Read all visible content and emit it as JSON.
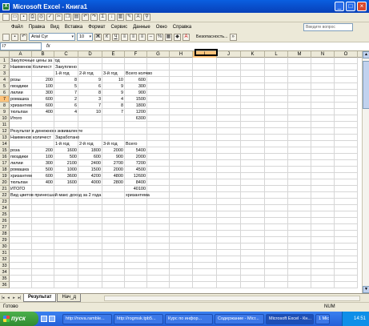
{
  "window": {
    "title": "Microsoft Excel - Книга1",
    "icon": "excel-icon"
  },
  "menu": [
    "Файл",
    "Правка",
    "Вид",
    "Вставка",
    "Формат",
    "Сервис",
    "Данные",
    "Окно",
    "Справка"
  ],
  "help_placeholder": "Введите вопрос",
  "font_name": "Arial Cyr",
  "font_size": "10",
  "security_label": "Безопасность...",
  "name_box": "I7",
  "formula_label": "fx",
  "columns": [
    "A",
    "B",
    "C",
    "D",
    "E",
    "F",
    "G",
    "H",
    "I",
    "J",
    "K",
    "L",
    "M",
    "N",
    "O"
  ],
  "selected_column": "I",
  "selected_row": 7,
  "rows": [
    {
      "n": 1,
      "cells": {
        "A": "Закупочные цены за год"
      }
    },
    {
      "n": 2,
      "cells": {
        "A": "Наименов",
        "B": "Количест",
        "C": "Закуплено"
      }
    },
    {
      "n": 3,
      "cells": {
        "C": "1-й год",
        "D": "2-й год",
        "E": "3-й год",
        "F": "Всего колчво"
      }
    },
    {
      "n": 4,
      "cells": {
        "A": "розы",
        "B": "200",
        "C": "8",
        "D": "9",
        "E": "10",
        "F": "600"
      }
    },
    {
      "n": 5,
      "cells": {
        "A": "гвоздики",
        "B": "100",
        "C": "5",
        "D": "6",
        "E": "9",
        "F": "300"
      }
    },
    {
      "n": 6,
      "cells": {
        "A": "лилии",
        "B": "300",
        "C": "7",
        "D": "8",
        "E": "9",
        "F": "900"
      }
    },
    {
      "n": 7,
      "cells": {
        "A": "ромашка",
        "B": "600",
        "C": "2",
        "D": "3",
        "E": "4",
        "F": "1500"
      }
    },
    {
      "n": 8,
      "cells": {
        "A": "хризантем",
        "B": "600",
        "C": "6",
        "D": "7",
        "E": "8",
        "F": "1800"
      }
    },
    {
      "n": 9,
      "cells": {
        "A": "тюльпан",
        "B": "400",
        "C": "4",
        "D": "10",
        "E": "7",
        "F": "1200"
      }
    },
    {
      "n": 10,
      "cells": {
        "A": "Итого",
        "F": "6300"
      }
    },
    {
      "n": 11,
      "cells": {}
    },
    {
      "n": 12,
      "cells": {
        "A": "Результат в денежном эквиваленте"
      }
    },
    {
      "n": 13,
      "cells": {
        "A": "Наименов",
        "B": "количест",
        "C": "Заработано"
      }
    },
    {
      "n": 14,
      "cells": {
        "C": "1-й год",
        "D": "2-й год",
        "E": "3-й год",
        "F": "Всего"
      }
    },
    {
      "n": 15,
      "cells": {
        "A": "роза",
        "B": "200",
        "C": "1600",
        "D": "1800",
        "E": "2000",
        "F": "5400"
      }
    },
    {
      "n": 16,
      "cells": {
        "A": "гвоздики",
        "B": "100",
        "C": "500",
        "D": "600",
        "E": "900",
        "F": "2000"
      }
    },
    {
      "n": 17,
      "cells": {
        "A": "лилии",
        "B": "300",
        "C": "2100",
        "D": "2400",
        "E": "2700",
        "F": "7200"
      }
    },
    {
      "n": 18,
      "cells": {
        "A": "ромашка",
        "B": "500",
        "C": "1000",
        "D": "1500",
        "E": "2000",
        "F": "4500"
      }
    },
    {
      "n": 19,
      "cells": {
        "A": "хризантем",
        "B": "600",
        "C": "3600",
        "D": "4200",
        "E": "4800",
        "F": "12600"
      }
    },
    {
      "n": 20,
      "cells": {
        "A": "тюльпан",
        "B": "400",
        "C": "1600",
        "D": "4000",
        "E": "2800",
        "F": "8400"
      }
    },
    {
      "n": 21,
      "cells": {
        "A": "ИТОГО",
        "F": "40100"
      }
    },
    {
      "n": 22,
      "cells": {
        "A": "Вид цветов принесший макс доход за 2 года",
        "F": "хризантема"
      }
    },
    {
      "n": 23,
      "cells": {}
    },
    {
      "n": 24,
      "cells": {}
    },
    {
      "n": 25,
      "cells": {}
    },
    {
      "n": 26,
      "cells": {}
    },
    {
      "n": 27,
      "cells": {}
    },
    {
      "n": 28,
      "cells": {}
    },
    {
      "n": 29,
      "cells": {}
    },
    {
      "n": 30,
      "cells": {}
    },
    {
      "n": 31,
      "cells": {}
    },
    {
      "n": 32,
      "cells": {}
    },
    {
      "n": 33,
      "cells": {}
    },
    {
      "n": 34,
      "cells": {}
    },
    {
      "n": 35,
      "cells": {}
    },
    {
      "n": 36,
      "cells": {}
    }
  ],
  "sheet_tabs": [
    {
      "label": "Результат",
      "active": true
    },
    {
      "label": "Нач_д",
      "active": false
    }
  ],
  "status": {
    "text": "Готово",
    "num": "NUM"
  },
  "taskbar": {
    "start": "пуск",
    "buttons": [
      {
        "label": "http://nova.ramble...",
        "active": false
      },
      {
        "label": "http://rogmsk.tpb5...",
        "active": false
      },
      {
        "label": "Курс по инфор...",
        "active": false
      },
      {
        "label": "Содержание - Micr...",
        "active": false
      },
      {
        "label": "Microsoft Excel - Кн...",
        "active": true
      },
      {
        "label": "1 Microsoft Office...",
        "active": false
      }
    ],
    "clock": "14:51"
  }
}
